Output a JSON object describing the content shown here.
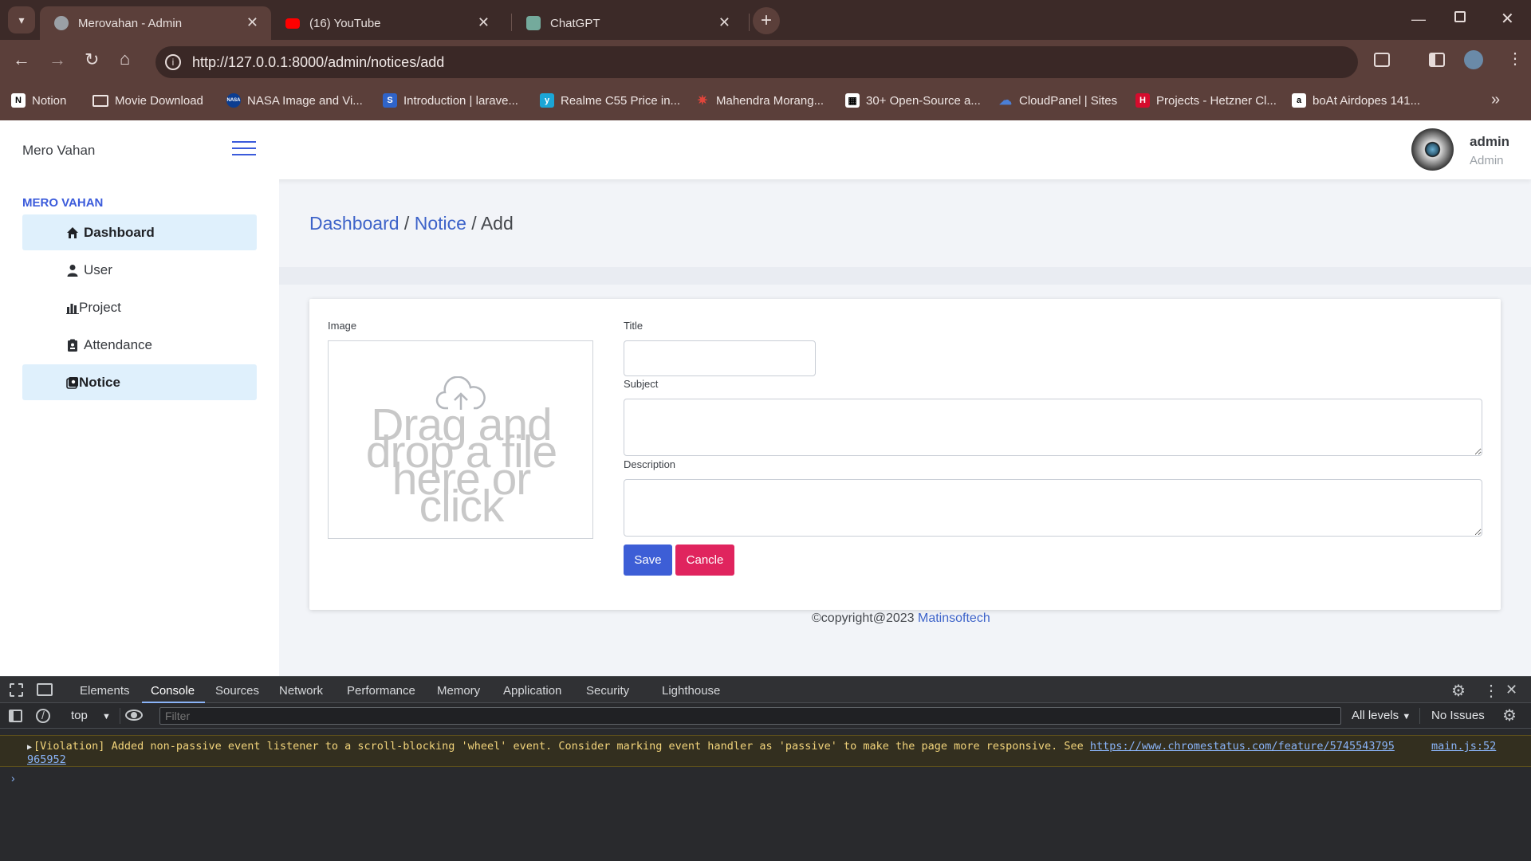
{
  "browser": {
    "tabs": [
      {
        "title": "Merovahan - Admin",
        "active": true
      },
      {
        "title": "(16) YouTube",
        "active": false
      },
      {
        "title": "ChatGPT",
        "active": false
      }
    ],
    "url": "http://127.0.0.1:8000/admin/notices/add",
    "bookmarks": [
      {
        "label": "Notion",
        "icon": "notion-icon"
      },
      {
        "label": "Movie Download",
        "icon": "folder-icon"
      },
      {
        "label": "NASA Image and Vi...",
        "icon": "nasa-icon"
      },
      {
        "label": "Introduction | larave...",
        "icon": "s-icon"
      },
      {
        "label": "Realme C55 Price in...",
        "icon": "y-icon"
      },
      {
        "label": "Mahendra Morang...",
        "icon": "star-emblem-icon"
      },
      {
        "label": "30+ Open-Source a...",
        "icon": "qr-icon"
      },
      {
        "label": "CloudPanel | Sites",
        "icon": "cloud-icon"
      },
      {
        "label": "Projects - Hetzner Cl...",
        "icon": "h-icon"
      },
      {
        "label": "boAt Airdopes 141...",
        "icon": "a-icon"
      }
    ]
  },
  "app": {
    "brand": "Mero Vahan",
    "user": {
      "name": "admin",
      "role": "Admin"
    },
    "sidebar": {
      "heading": "MERO VAHAN",
      "items": [
        {
          "label": "Dashboard",
          "icon": "home-icon",
          "highlighted": true
        },
        {
          "label": "User",
          "icon": "user-icon",
          "highlighted": false
        },
        {
          "label": "Project",
          "icon": "chart-icon",
          "highlighted": false
        },
        {
          "label": "Attendance",
          "icon": "clipboard-icon",
          "highlighted": false
        },
        {
          "label": "Notice",
          "icon": "notice-icon",
          "highlighted": true
        }
      ]
    },
    "breadcrumb": {
      "dashboard": "Dashboard",
      "notice": "Notice",
      "sep": "/",
      "current": "Add"
    },
    "form": {
      "image_label": "Image",
      "dropzone_text": "Drag and drop a file here or click",
      "title_label": "Title",
      "title_value": "",
      "subject_label": "Subject",
      "subject_value": "",
      "description_label": "Description",
      "description_value": "",
      "save_label": "Save",
      "cancel_label": "Cancle"
    },
    "footer": {
      "copyright": "©copyright@2023",
      "company": "Matinsoftech"
    }
  },
  "devtools": {
    "tabs": [
      "Elements",
      "Console",
      "Sources",
      "Network",
      "Performance",
      "Memory",
      "Application",
      "Security",
      "Lighthouse"
    ],
    "active_tab": "Console",
    "context": "top",
    "filter_placeholder": "Filter",
    "levels": "All levels",
    "issues": "No Issues",
    "message": "[Violation] Added non-passive event listener to a scroll-blocking 'wheel' event. Consider marking event handler as 'passive' to make the page more responsive. See",
    "message_link": "https://www.chromestatus.com/feature/5745543795965952",
    "message_link_line1": "https://www.chromestatus.com/feature/5745543795",
    "message_link_line2": "965952",
    "source": "main.js:52"
  },
  "colors": {
    "accent": "#3b5bdb",
    "breadcrumb_link": "#3d63c9",
    "save": "#3d5ed6",
    "cancel": "#e0245e",
    "sidebar_highlight": "#dff0fc",
    "devtools_bg": "#292a2d"
  }
}
